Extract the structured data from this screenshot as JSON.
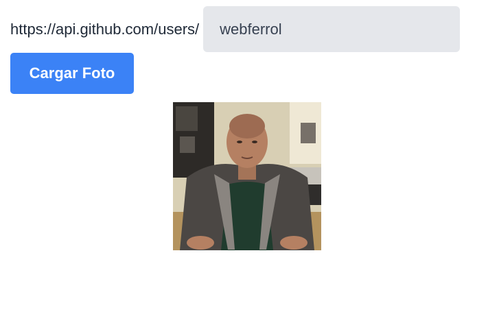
{
  "form": {
    "url_prefix": "https://api.github.com/users/",
    "username_value": "webferrol",
    "load_button_label": "Cargar Foto"
  },
  "avatar": {
    "icon": "user-avatar-photo"
  },
  "colors": {
    "button_bg": "#3b82f6",
    "input_bg": "#e5e7eb"
  }
}
